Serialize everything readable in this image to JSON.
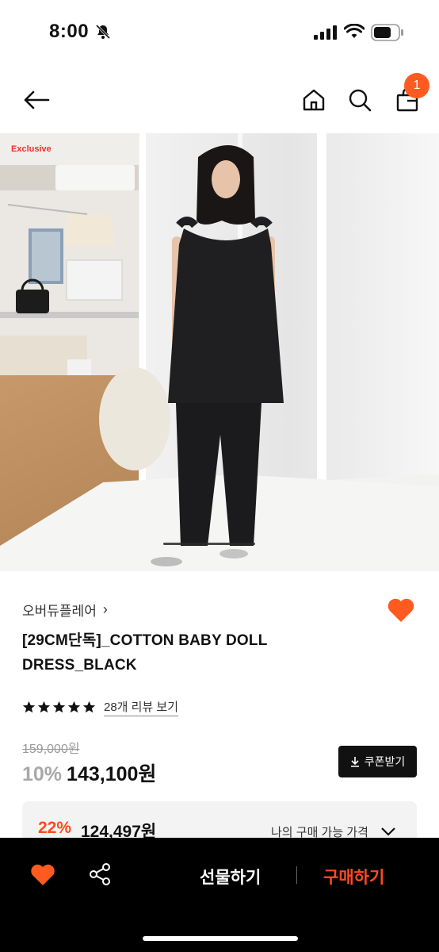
{
  "status_bar": {
    "time": "8:00"
  },
  "nav": {
    "cart_count": "1"
  },
  "image": {
    "label": "Exclusive"
  },
  "product": {
    "brand": "오버듀플레어",
    "brand_chevron": "›",
    "title": "[29CM단독]_COTTON BABY DOLL DRESS_BLACK",
    "rating_stars": 5,
    "review_link": "28개 리뷰 보기",
    "original_price": "159,000원",
    "discount_rate": "10%",
    "sale_price": "143,100원",
    "coupon_label": "쿠폰받기"
  },
  "member_price": {
    "discount": "22%",
    "price": "124,497원",
    "label": "나의 구매 가능 가격"
  },
  "bottom_bar": {
    "gift_label": "선물하기",
    "buy_label": "구매하기"
  },
  "colors": {
    "accent": "#ff4b1f",
    "badge": "#ff5a1f",
    "exclusive": "#e8332a"
  }
}
